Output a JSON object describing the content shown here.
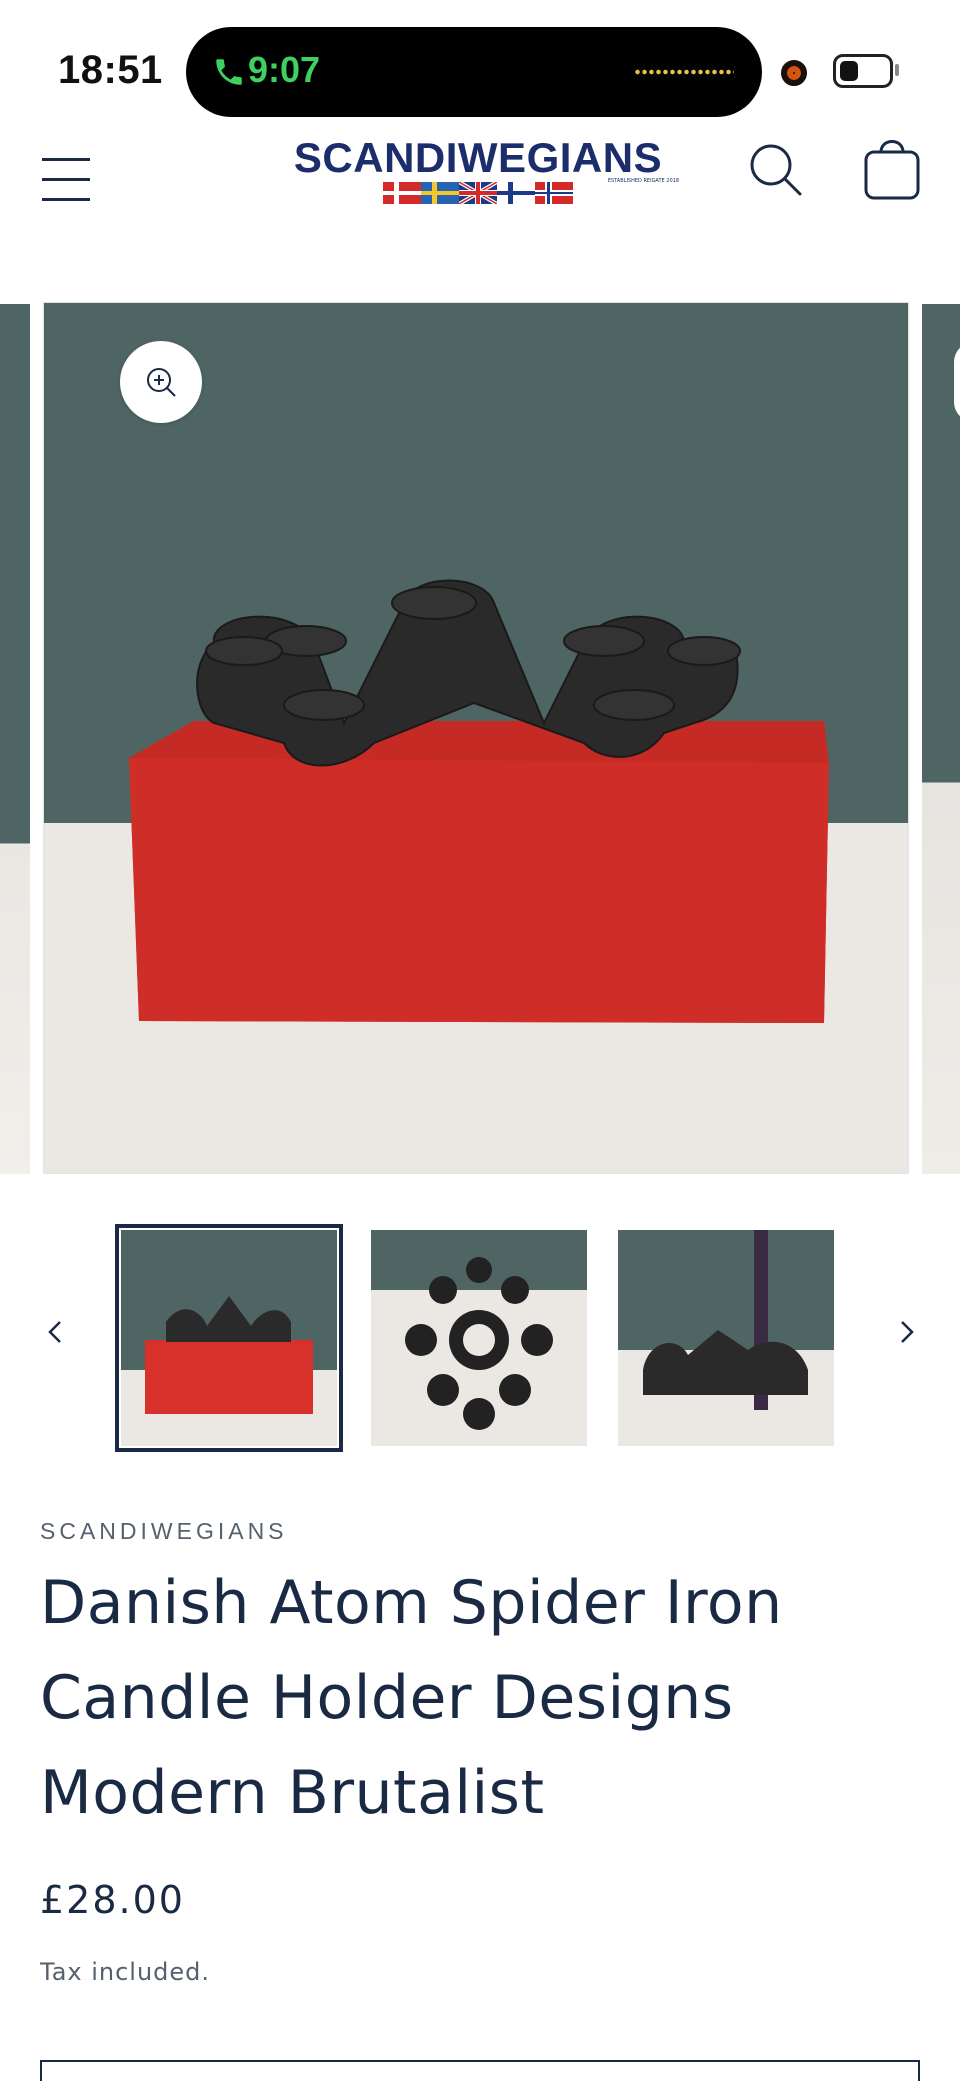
{
  "status_bar": {
    "time": "18:51",
    "call_time": "9:07",
    "call_color": "#3ed160"
  },
  "header": {
    "logo_text": "SCANDIWEGIANS",
    "logo_tagline": "ESTABLISHED REIGATE 2018",
    "brand_color": "#1b2d6b"
  },
  "gallery": {
    "zoom_icon": "zoom-in-icon",
    "thumbnails": [
      {
        "label": "candle-holder-on-red-box"
      },
      {
        "label": "candle-holder-top-view"
      },
      {
        "label": "candle-holder-with-candle"
      }
    ],
    "prev_icon": "chevron-left-icon",
    "next_icon": "chevron-right-icon"
  },
  "product": {
    "vendor": "SCANDIWEGIANS",
    "title": "Danish Atom Spider Iron Candle Holder Designs Modern Brutalist",
    "price": "£28.00",
    "tax_note": "Tax included."
  },
  "colors": {
    "text": "#1a2a44",
    "muted": "#55616f",
    "wall": "#4e6563",
    "box": "#d8312b"
  }
}
